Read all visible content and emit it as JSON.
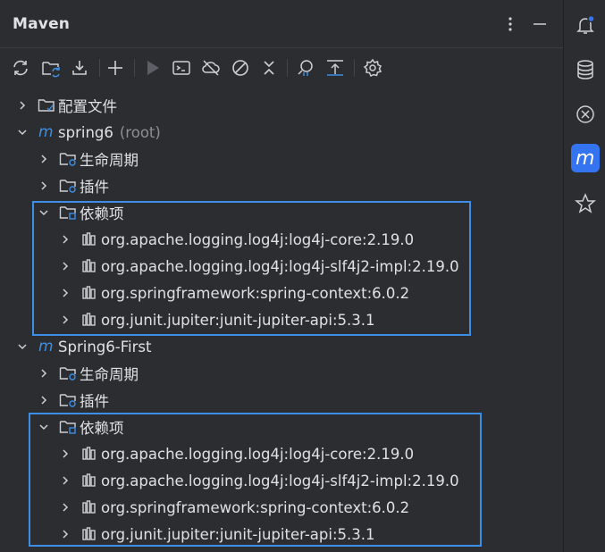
{
  "header": {
    "title": "Maven"
  },
  "toolbar": {
    "icons": [
      "reload-icon",
      "reimport-icon",
      "download-icon",
      "add-icon",
      "run-icon",
      "execute-goal-icon",
      "offline-icon",
      "skip-tests-icon",
      "collapse-icon",
      "analyze-icon",
      "show-dependencies-icon",
      "settings-icon"
    ]
  },
  "tree": {
    "config_files": "配置文件",
    "project1": {
      "name": "spring6",
      "tag": "(root)"
    },
    "project2": {
      "name": "Spring6-First"
    },
    "lifecycle": "生命周期",
    "plugins": "插件",
    "dependencies": "依赖项",
    "deps": [
      "org.apache.logging.log4j:log4j-core:2.19.0",
      "org.apache.logging.log4j:log4j-slf4j2-impl:2.19.0",
      "org.springframework:spring-context:6.0.2",
      "org.junit.jupiter:junit-jupiter-api:5.3.1"
    ]
  },
  "colors": {
    "accent": "#3574f0",
    "highlight_border": "#3d8ee6",
    "background": "#2b2d30"
  }
}
